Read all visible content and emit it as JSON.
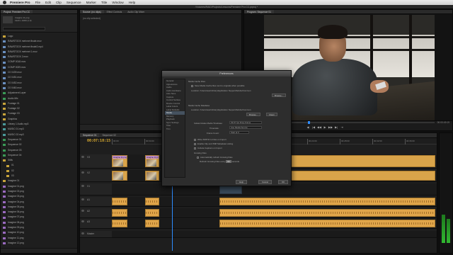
{
  "menubar": {
    "app_name": "Premiere Pro",
    "items": [
      "File",
      "Edit",
      "Clip",
      "Sequence",
      "Marker",
      "Title",
      "Window",
      "Help"
    ]
  },
  "window": {
    "title": "/Volumes/RAID/Projects/Lessons/Premiere Pro CC.prproj *"
  },
  "project": {
    "tab_label": "Project: Premiere Pro CC",
    "selected_clip": "Imagine 11.png",
    "selected_meta": "1920 x 1080 (1.0)",
    "search_placeholder": "",
    "bins": [
      {
        "icon": "folder",
        "name": "Logo"
      },
      {
        "icon": "clip",
        "name": "RAWSTOCK mehmet finale.mov"
      },
      {
        "icon": "clip",
        "name": "RAWSTOCK mehmet finale2.mp4"
      },
      {
        "icon": "clip",
        "name": "RAWSTOCK mehmet 1.mov"
      },
      {
        "icon": "clip",
        "name": "RAWSTOCK 2.mov"
      },
      {
        "icon": "clip",
        "name": "COMP 0018.mov"
      },
      {
        "icon": "clip",
        "name": "COMP 0029.mov"
      },
      {
        "icon": "clip",
        "name": "C0 0439.mov"
      },
      {
        "icon": "clip",
        "name": "C0 0451.mov"
      },
      {
        "icon": "clip",
        "name": "C0 0452.mov"
      },
      {
        "icon": "clip",
        "name": "C0 0460.mov"
      },
      {
        "icon": "seq",
        "name": "Adjustment Layer"
      },
      {
        "icon": "seq",
        "name": "Audio Mix"
      },
      {
        "icon": "folder",
        "name": "Footage 01"
      },
      {
        "icon": "folder",
        "name": "Footage 02"
      },
      {
        "icon": "folder",
        "name": "Footage 03"
      },
      {
        "icon": "folder",
        "name": "Graphics"
      },
      {
        "icon": "audio",
        "name": "Library 1 Audio.mp3"
      },
      {
        "icon": "audio",
        "name": "MUSIC 01.mp3"
      },
      {
        "icon": "audio",
        "name": "MUSIC 02.mp3"
      },
      {
        "icon": "seq",
        "name": "Sequence 01"
      },
      {
        "icon": "seq",
        "name": "Sequence 02"
      },
      {
        "icon": "seq",
        "name": "Sequence 03"
      },
      {
        "icon": "seq",
        "name": "Sequence 04"
      },
      {
        "icon": "folder",
        "name": "Stills"
      },
      {
        "icon": "folder",
        "name": "01"
      },
      {
        "icon": "folder",
        "name": "02"
      },
      {
        "icon": "folder",
        "name": "03"
      },
      {
        "icon": "folder",
        "name": "Imagine 01"
      },
      {
        "icon": "still",
        "name": "Imagine 01.png"
      },
      {
        "icon": "still",
        "name": "Imagine 02.png"
      },
      {
        "icon": "still",
        "name": "Imagine 03.png"
      },
      {
        "icon": "still",
        "name": "Imagine 04.png"
      },
      {
        "icon": "still",
        "name": "Imagine 05.png"
      },
      {
        "icon": "still",
        "name": "Imagine 06.png"
      },
      {
        "icon": "still",
        "name": "Imagine 07.png"
      },
      {
        "icon": "still",
        "name": "Imagine 08.png"
      },
      {
        "icon": "still",
        "name": "Imagine 09.png"
      },
      {
        "icon": "still",
        "name": "Imagine 10.png"
      },
      {
        "icon": "still",
        "name": "Imagine 11.png"
      },
      {
        "icon": "still",
        "name": "Imagine 12.png"
      }
    ]
  },
  "source": {
    "tabs": [
      "Source: (no clips)",
      "Effect Controls",
      "Audio Clip Mixer"
    ],
    "empty_label": "(no clip selected)"
  },
  "program": {
    "tab_label": "Program: Sequence 01",
    "timecode": "00:00:49:19",
    "transport": [
      "◀",
      "|◀",
      "◀◀",
      "▶",
      "▶▶",
      "▶|",
      "⇥"
    ]
  },
  "timeline": {
    "tabs": [
      "Sequence 01",
      "Sequence 02"
    ],
    "timecode": "00:07:10:15",
    "ruler_ticks": [
      "00:00",
      "00:04:00",
      "00:08:00",
      "00:12:00",
      "00:16:00",
      "00:20:00",
      "00:24:00",
      "00:28:00",
      "00:32:00",
      "00:36:00"
    ],
    "tracks": [
      {
        "name": "V3",
        "kind": "video"
      },
      {
        "name": "V2",
        "kind": "video"
      },
      {
        "name": "V1",
        "kind": "video"
      },
      {
        "name": "A1",
        "kind": "audio"
      },
      {
        "name": "A2",
        "kind": "audio"
      },
      {
        "name": "A3",
        "kind": "audio"
      },
      {
        "name": "Master",
        "kind": "audio"
      }
    ],
    "clip_label": "Imagine 11.png"
  },
  "prefs": {
    "title": "Preferences",
    "categories": [
      "General",
      "Appearance",
      "Audio",
      "Audio Hardware",
      "Auto Save",
      "Capture",
      "Control Surface",
      "Device Control",
      "Label Colors",
      "Label Defaults",
      "Media",
      "Memory",
      "Playback",
      "Sync Settings",
      "Titler",
      "Trim"
    ],
    "selected_category": "Media",
    "media_cache_files": "Media Cache Files",
    "save_next_to": "Save Media Cache files next to originals when possible",
    "location1": "Location: /Users/user/Library/Application Support/Adobe/Common",
    "browse": "Browse...",
    "media_cache_db": "Media Cache Database",
    "location2": "Location: /Users/user/Library/Application Support/Adobe/Common",
    "clean": "Clean",
    "indeterminate_label": "Indeterminate Media Timebase:",
    "indeterminate_value": "29.97 fps Drop-Frame",
    "timecode_label": "Timecode:",
    "timecode_value": "Use Media Source",
    "frame_count_label": "Frame Count:",
    "frame_count_value": "Start at 0",
    "write_xmp": "Write XMP ID to Files on Import",
    "enable_clip": "Enable Clip and XMP Metadata Linking",
    "include_captions": "Include Captions on Import",
    "growing_files": "Growing Files",
    "auto_refresh": "Automatically refresh Growing Files",
    "refresh_every": "Refresh Growing Files every",
    "refresh_value": "60",
    "refresh_unit": "seconds",
    "help": "Help",
    "cancel": "Cancel",
    "ok": "OK"
  }
}
